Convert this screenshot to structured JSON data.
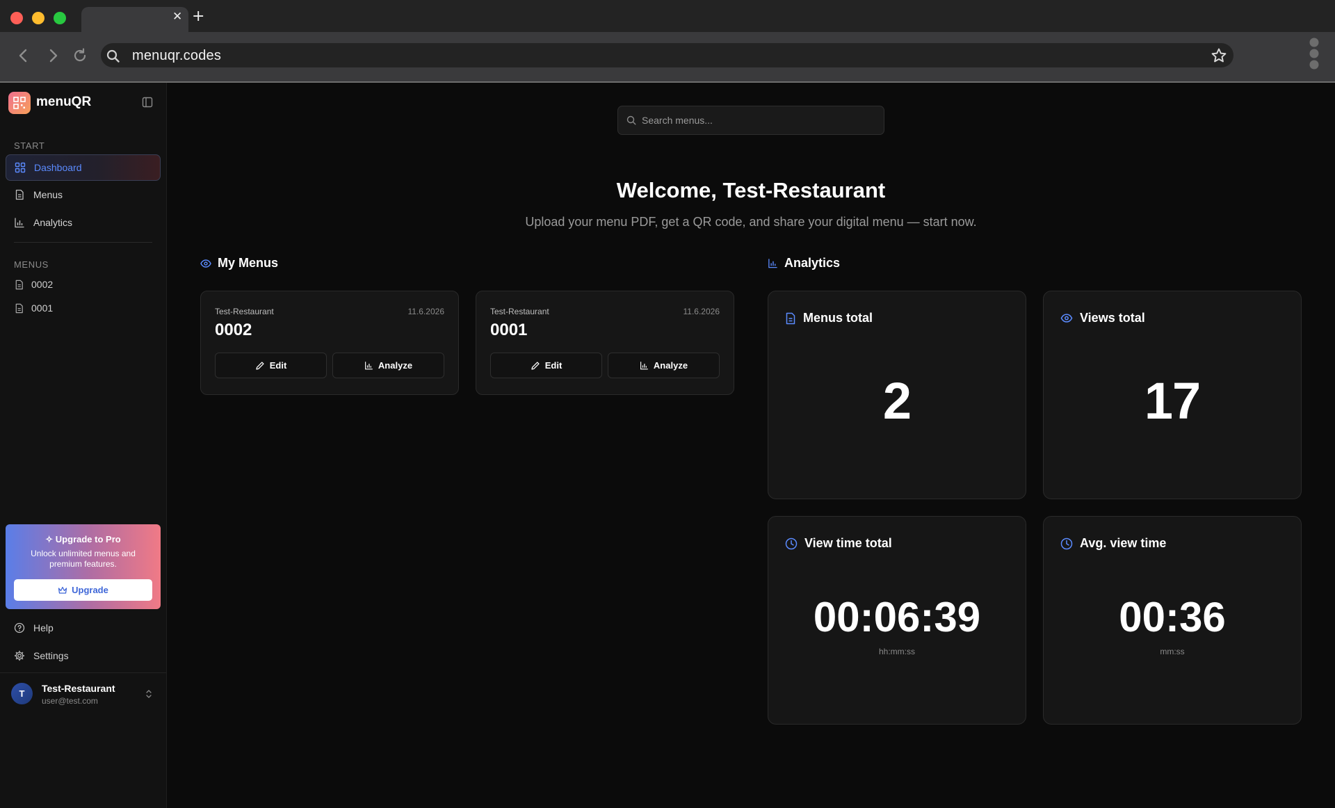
{
  "browser": {
    "url": "menuqr.codes"
  },
  "sidebar": {
    "brand": "menuQR",
    "start_label": "START",
    "nav": [
      {
        "label": "Dashboard"
      },
      {
        "label": "Menus"
      },
      {
        "label": "Analytics"
      }
    ],
    "menus_label": "MENUS",
    "menus": [
      {
        "label": "0002"
      },
      {
        "label": "0001"
      }
    ],
    "upgrade": {
      "title": "Upgrade to Pro",
      "text": "Unlock unlimited menus and premium features.",
      "button": "Upgrade"
    },
    "help": "Help",
    "settings": "Settings",
    "user": {
      "initial": "T",
      "name": "Test-Restaurant",
      "email": "user@test.com"
    }
  },
  "main": {
    "search_placeholder": "Search menus...",
    "welcome": "Welcome, Test-Restaurant",
    "subtitle": "Upload your menu PDF, get a QR code, and share your digital menu — start now.",
    "my_menus_heading": "My Menus",
    "analytics_heading": "Analytics",
    "menu_cards": [
      {
        "restaurant": "Test-Restaurant",
        "date": "11.6.2026",
        "title": "0002",
        "edit": "Edit",
        "analyze": "Analyze"
      },
      {
        "restaurant": "Test-Restaurant",
        "date": "11.6.2026",
        "title": "0001",
        "edit": "Edit",
        "analyze": "Analyze"
      }
    ],
    "stats": [
      {
        "label": "Menus total",
        "value": "2",
        "unit": ""
      },
      {
        "label": "Views total",
        "value": "17",
        "unit": ""
      },
      {
        "label": "View time total",
        "value": "00:06:39",
        "unit": "hh:mm:ss"
      },
      {
        "label": "Avg. view time",
        "value": "00:36",
        "unit": "mm:ss"
      }
    ]
  },
  "colors": {
    "accent": "#5b8bff",
    "background": "#0b0b0b",
    "card": "#161616"
  }
}
